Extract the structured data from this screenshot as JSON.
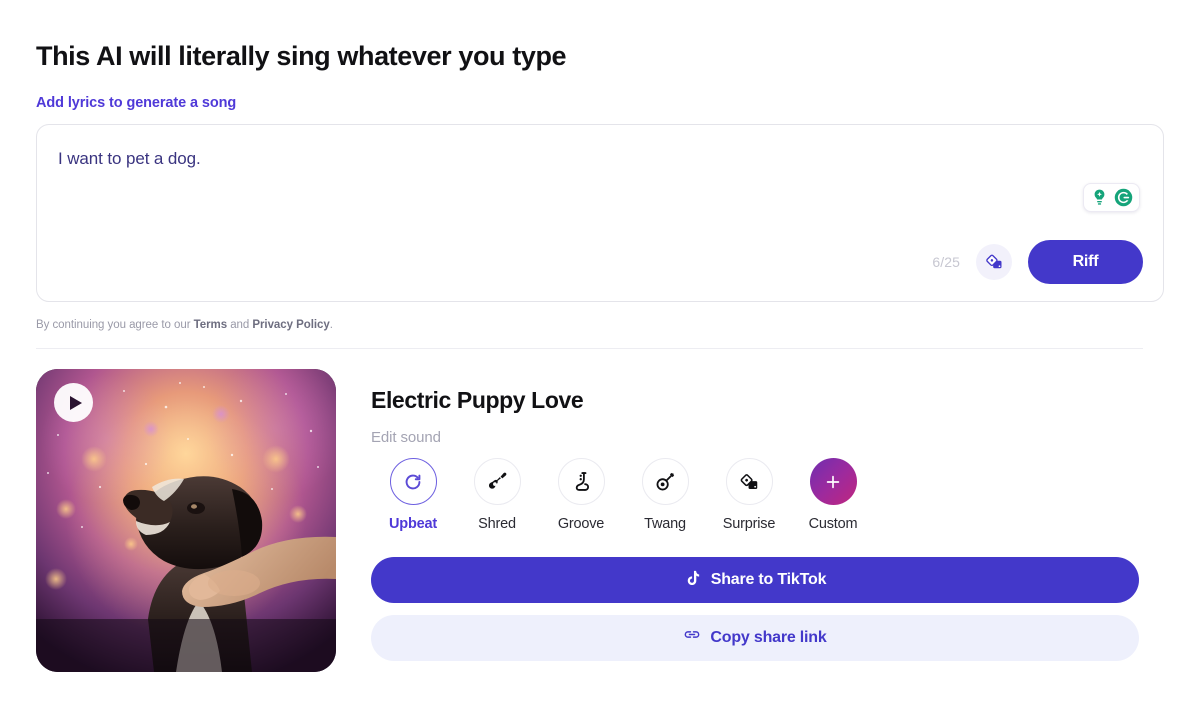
{
  "headline": "This AI will literally sing whatever you type",
  "lyrics_section": {
    "label": "Add lyrics to generate a song",
    "value": "I want to pet a dog.",
    "placeholder": "Add lyrics to generate a song",
    "counter": "6/25",
    "riff_label": "Riff",
    "dice_icon": "dice-randomize-icon",
    "grammarly_icons": [
      "lightbulb-suggestion-icon",
      "grammarly-logo-icon"
    ]
  },
  "terms": {
    "prefix": "By continuing you agree to our ",
    "terms_label": "Terms",
    "middle": " and ",
    "privacy_label": "Privacy Policy",
    "suffix": "."
  },
  "result": {
    "thumbnail_alt": "dog being petted under glowing bokeh sky",
    "play_icon": "play-icon",
    "song_title": "Electric Puppy Love",
    "edit_sound_label": "Edit sound",
    "sounds": [
      {
        "label": "Upbeat",
        "icon": "refresh-circle-icon",
        "selected": true
      },
      {
        "label": "Shred",
        "icon": "electric-guitar-icon",
        "selected": false
      },
      {
        "label": "Groove",
        "icon": "saxophone-icon",
        "selected": false
      },
      {
        "label": "Twang",
        "icon": "banjo-icon",
        "selected": false
      },
      {
        "label": "Surprise",
        "icon": "dice-icon",
        "selected": false
      },
      {
        "label": "Custom",
        "icon": "plus-icon",
        "selected": false
      }
    ],
    "share_tiktok_label": "Share to TikTok",
    "share_tiktok_icon": "tiktok-note-icon",
    "copy_link_label": "Copy share link",
    "copy_link_icon": "link-chain-icon"
  },
  "colors": {
    "accent": "#4338ca",
    "accent_text": "#4f39d8",
    "grammarly_green": "#15a47a",
    "custom_gradient_start": "#6f2fb0",
    "custom_gradient_end": "#c0267e",
    "muted": "#a4a4b3"
  }
}
